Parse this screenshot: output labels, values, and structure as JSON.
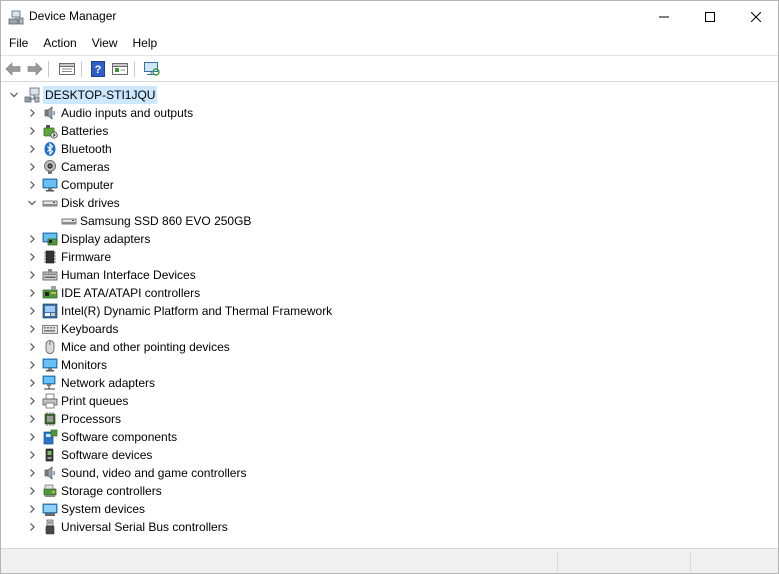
{
  "window": {
    "title": "Device Manager"
  },
  "menu": {
    "items": [
      "File",
      "Action",
      "View",
      "Help"
    ]
  },
  "toolbar": {
    "buttons": [
      "back-arrow-icon",
      "forward-arrow-icon",
      "properties-icon",
      "help-icon",
      "update-driver-icon",
      "scan-hardware-icon"
    ]
  },
  "tree": {
    "root": {
      "label": "DESKTOP-STI1JQU",
      "icon": "computer-network-icon",
      "expanded": true,
      "selected": true
    },
    "categories": [
      {
        "label": "Audio inputs and outputs",
        "icon": "speaker-icon",
        "expanded": false
      },
      {
        "label": "Batteries",
        "icon": "battery-icon",
        "expanded": false
      },
      {
        "label": "Bluetooth",
        "icon": "bluetooth-icon",
        "expanded": false
      },
      {
        "label": "Cameras",
        "icon": "camera-icon",
        "expanded": false
      },
      {
        "label": "Computer",
        "icon": "monitor-icon",
        "expanded": false
      },
      {
        "label": "Disk drives",
        "icon": "disk-drive-icon",
        "expanded": true,
        "children": [
          {
            "label": "Samsung SSD 860 EVO 250GB",
            "icon": "disk-drive-icon"
          }
        ]
      },
      {
        "label": "Display adapters",
        "icon": "display-adapter-icon",
        "expanded": false
      },
      {
        "label": "Firmware",
        "icon": "chip-icon",
        "expanded": false
      },
      {
        "label": "Human Interface Devices",
        "icon": "hid-icon",
        "expanded": false
      },
      {
        "label": "IDE ATA/ATAPI controllers",
        "icon": "ide-controller-icon",
        "expanded": false
      },
      {
        "label": "Intel(R) Dynamic Platform and Thermal Framework",
        "icon": "platform-icon",
        "expanded": false
      },
      {
        "label": "Keyboards",
        "icon": "keyboard-icon",
        "expanded": false
      },
      {
        "label": "Mice and other pointing devices",
        "icon": "mouse-icon",
        "expanded": false
      },
      {
        "label": "Monitors",
        "icon": "monitor-icon",
        "expanded": false
      },
      {
        "label": "Network adapters",
        "icon": "network-adapter-icon",
        "expanded": false
      },
      {
        "label": "Print queues",
        "icon": "printer-icon",
        "expanded": false
      },
      {
        "label": "Processors",
        "icon": "processor-icon",
        "expanded": false
      },
      {
        "label": "Software components",
        "icon": "software-component-icon",
        "expanded": false
      },
      {
        "label": "Software devices",
        "icon": "software-device-icon",
        "expanded": false
      },
      {
        "label": "Sound, video and game controllers",
        "icon": "speaker-icon",
        "expanded": false
      },
      {
        "label": "Storage controllers",
        "icon": "storage-controller-icon",
        "expanded": false
      },
      {
        "label": "System devices",
        "icon": "system-devices-icon",
        "expanded": false
      },
      {
        "label": "Universal Serial Bus controllers",
        "icon": "usb-icon",
        "expanded": false
      }
    ]
  },
  "colors": {
    "selection": "#cce8ff",
    "accent": "#0078d7",
    "chevron": "#606060"
  }
}
